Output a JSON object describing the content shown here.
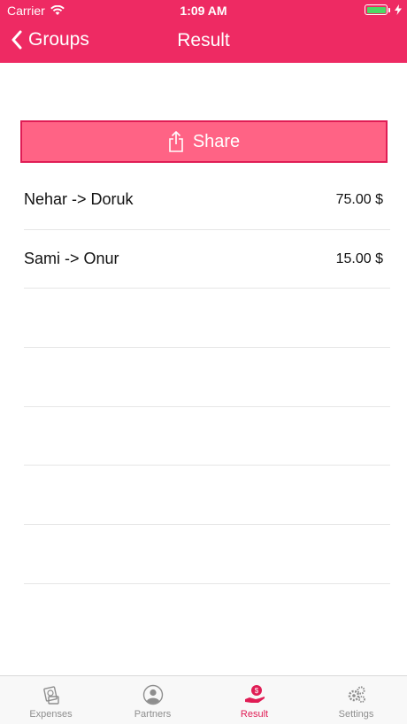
{
  "status_bar": {
    "carrier": "Carrier",
    "time": "1:09 AM"
  },
  "nav": {
    "back_label": "Groups",
    "title": "Result"
  },
  "share_button": {
    "label": "Share"
  },
  "results": [
    {
      "label": "Nehar -> Doruk",
      "amount": "75.00 $"
    },
    {
      "label": "Sami -> Onur",
      "amount": "15.00 $"
    },
    {
      "label": "",
      "amount": ""
    },
    {
      "label": "",
      "amount": ""
    },
    {
      "label": "",
      "amount": ""
    },
    {
      "label": "",
      "amount": ""
    },
    {
      "label": "",
      "amount": ""
    },
    {
      "label": "",
      "amount": ""
    }
  ],
  "tabbar": {
    "tabs": [
      {
        "label": "Expenses",
        "icon": "expenses-icon",
        "active": false
      },
      {
        "label": "Partners",
        "icon": "partners-icon",
        "active": false
      },
      {
        "label": "Result",
        "icon": "result-icon",
        "active": true
      },
      {
        "label": "Settings",
        "icon": "settings-icon",
        "active": false
      }
    ]
  },
  "colors": {
    "accent": "#ee2a63",
    "share_button": "#ff6385",
    "battery": "#4cd964"
  }
}
